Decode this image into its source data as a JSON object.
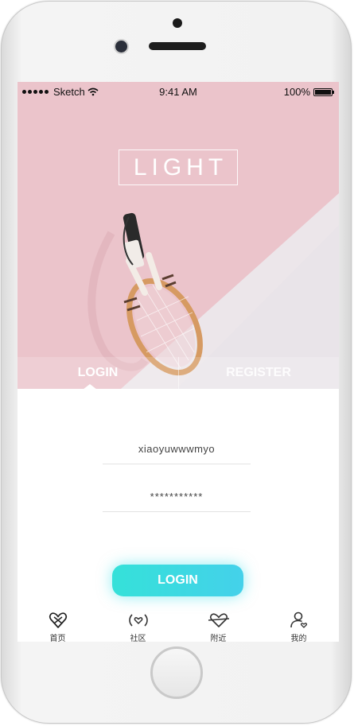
{
  "status_bar": {
    "carrier": "Sketch",
    "time": "9:41 AM",
    "battery": "100%"
  },
  "hero": {
    "logo_text": "LIGHT"
  },
  "tabs": {
    "login_label": "LOGIN",
    "register_label": "REGISTER"
  },
  "form": {
    "username_value": "xiaoyuwwwmyo",
    "password_value": "***********",
    "submit_label": "LOGIN"
  },
  "bottom_nav": {
    "items": [
      {
        "label": "首页",
        "icon": "home-heart-icon"
      },
      {
        "label": "社区",
        "icon": "community-signal-icon"
      },
      {
        "label": "附近",
        "icon": "nearby-heart-icon"
      },
      {
        "label": "我的",
        "icon": "profile-icon"
      }
    ]
  },
  "colors": {
    "hero_pink": "#ebc4cb",
    "button_start": "#35e1d9",
    "button_end": "#44d1ea"
  }
}
